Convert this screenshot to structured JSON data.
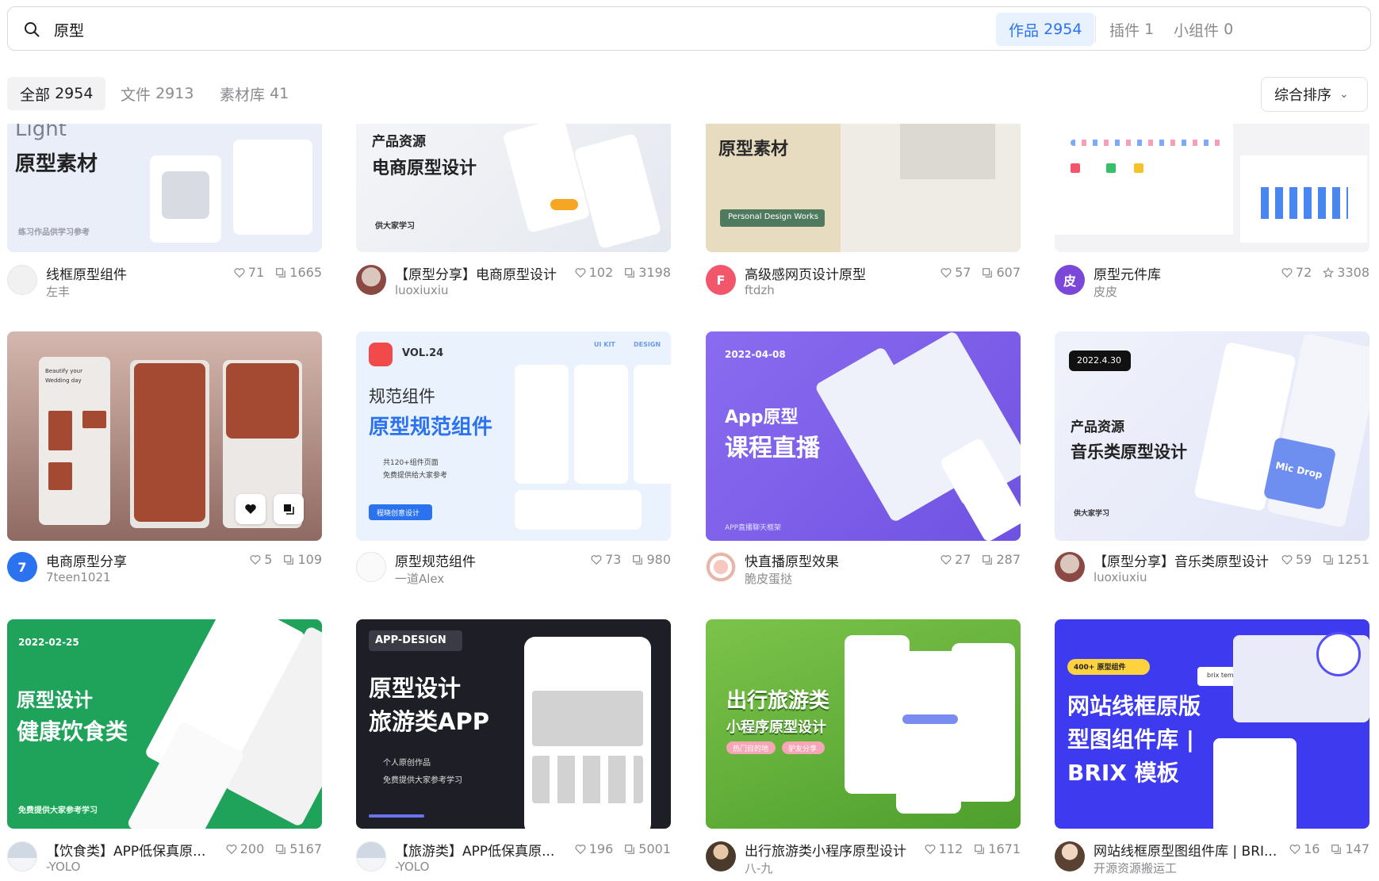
{
  "search": {
    "query": "原型",
    "scopes": [
      {
        "label": "作品",
        "count": "2954"
      },
      {
        "label": "插件",
        "count": "1"
      },
      {
        "label": "小组件",
        "count": "0"
      }
    ]
  },
  "filters": {
    "tabs": [
      {
        "label": "全部",
        "count": "2954"
      },
      {
        "label": "文件",
        "count": "2913"
      },
      {
        "label": "素材库",
        "count": "41"
      }
    ],
    "sort_label": "综合排序"
  },
  "colors": {
    "accent": "#2b72f0",
    "accent_bg": "#e8f1fe"
  },
  "cards": [
    {
      "title": "线框原型组件",
      "author": "左丰",
      "likes": "71",
      "second_stat": "1665",
      "second_icon": "copy-icon",
      "thumb_lines": [
        "Light",
        "原型素材",
        "练习作品供学习参考"
      ]
    },
    {
      "title": "【原型分享】电商原型设计",
      "author": "luoxiuxiu",
      "likes": "102",
      "second_stat": "3198",
      "second_icon": "copy-icon",
      "thumb_lines": [
        "产品资源",
        "电商原型设计",
        "供大家学习"
      ]
    },
    {
      "title": "高级感网页设计原型",
      "author": "ftdzh",
      "likes": "57",
      "second_stat": "607",
      "second_icon": "copy-icon",
      "avatar_letter": "F",
      "thumb_lines": [
        "原型素材",
        "Personal Design Works"
      ]
    },
    {
      "title": "原型元件库",
      "author": "皮皮",
      "likes": "72",
      "second_stat": "3308",
      "second_icon": "star-icon",
      "avatar_letter": "皮",
      "thumb_lines": []
    },
    {
      "title": "电商原型分享",
      "author": "7teen1021",
      "likes": "5",
      "second_stat": "109",
      "second_icon": "copy-icon",
      "avatar_letter": "7",
      "thumb_lines": [
        "Beautify your",
        "Wedding day"
      ]
    },
    {
      "title": "原型规范组件",
      "author": "一道Alex",
      "likes": "73",
      "second_stat": "980",
      "second_icon": "copy-icon",
      "thumb_lines": [
        "VOL.24",
        "规范组件",
        "原型规范组件",
        "共120+组件页面",
        "免费提供给大家参考",
        "程晓创意设计",
        "UI KIT",
        "DESIGN"
      ]
    },
    {
      "title": "快直播原型效果",
      "author": "脆皮蛋挞",
      "likes": "27",
      "second_stat": "287",
      "second_icon": "copy-icon",
      "thumb_lines": [
        "2022-04-08",
        "App原型",
        "课程直播",
        "APP直播聊天框架"
      ]
    },
    {
      "title": "【原型分享】音乐类原型设计",
      "author": "luoxiuxiu",
      "likes": "59",
      "second_stat": "1251",
      "second_icon": "copy-icon",
      "thumb_lines": [
        "2022.4.30",
        "产品资源",
        "音乐类原型设计",
        "供大家学习",
        "Mic Drop"
      ]
    },
    {
      "title": "【饮食类】APP低保真原...",
      "author": "-YOLO",
      "likes": "200",
      "second_stat": "5167",
      "second_icon": "copy-icon",
      "thumb_lines": [
        "2022-02-25",
        "原型设计",
        "健康饮食类",
        "免费提供大家参考学习"
      ]
    },
    {
      "title": "【旅游类】APP低保真原...",
      "author": "-YOLO",
      "likes": "196",
      "second_stat": "5001",
      "second_icon": "copy-icon",
      "thumb_lines": [
        "APP-DESIGN",
        "原型设计",
        "旅游类APP",
        "个人原创作品",
        "免费提供大家参考学习"
      ]
    },
    {
      "title": "出行旅游类小程序原型设计",
      "author": "八-九",
      "likes": "112",
      "second_stat": "1671",
      "second_icon": "copy-icon",
      "thumb_lines": [
        "出行旅游类",
        "小程序原型设计",
        "热门目的地",
        "驴友分享"
      ]
    },
    {
      "title": "网站线框原型图组件库 | BRI...",
      "author": "开源资源搬运工",
      "likes": "16",
      "second_stat": "147",
      "second_icon": "copy-icon",
      "thumb_lines": [
        "400+ 原型组件",
        "网站线框原版",
        "型图组件库 |",
        "BRIX 模板",
        "brix templates"
      ]
    }
  ]
}
